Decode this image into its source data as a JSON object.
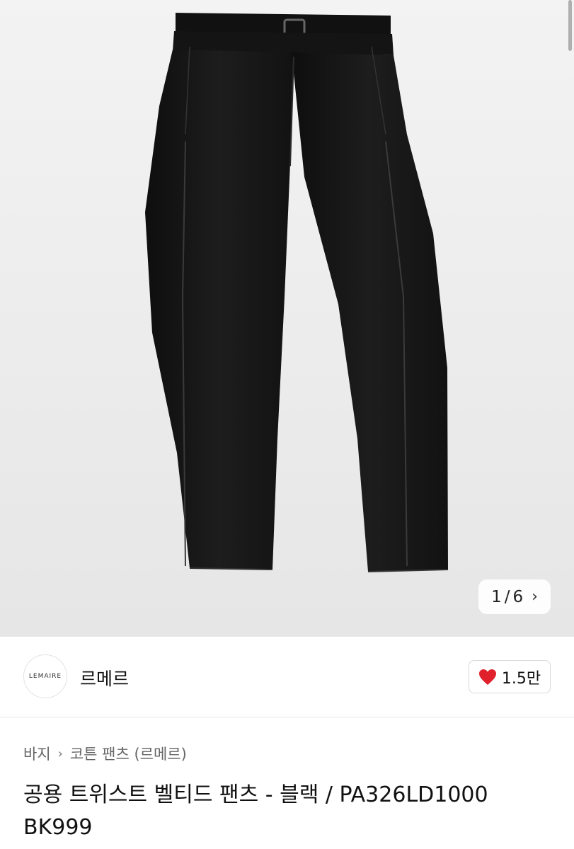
{
  "product_image": {
    "alt": "product-photo",
    "counter_current": "1",
    "counter_separator": "/",
    "counter_total": "6"
  },
  "brand": {
    "logo_text": "LEMAIRE",
    "name": "르메르",
    "likes": "1.5만"
  },
  "breadcrumb": {
    "category": "바지",
    "subcategory": "코튼 팬츠 (르메르)"
  },
  "product": {
    "title": "공용 트위스트 벨티드 팬츠 - 블랙 / PA326LD1000 BK999"
  },
  "colors": {
    "heart": "#e0202a",
    "pants": "#151515"
  }
}
